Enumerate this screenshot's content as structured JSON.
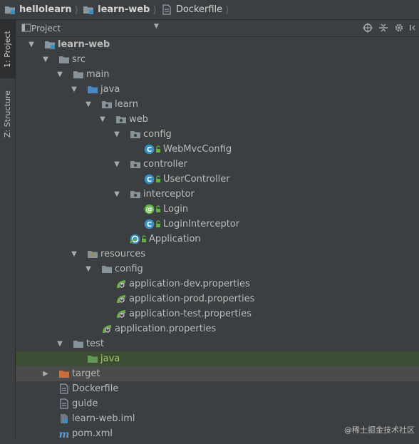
{
  "breadcrumb": [
    {
      "label": "hellolearn",
      "icon": "module-folder-icon",
      "bold": true
    },
    {
      "label": "learn-web",
      "icon": "module-folder-icon",
      "bold": true
    },
    {
      "label": "Dockerfile",
      "icon": "file-icon",
      "bold": false
    }
  ],
  "sidebar_tabs": [
    {
      "label": "1: Project",
      "active": true
    },
    {
      "label": "Z: Structure",
      "active": false
    }
  ],
  "project_header": {
    "label": "Project",
    "view_icon": "project-view-icon",
    "dropdown_icon": "caret-down-icon"
  },
  "header_tools": [
    "crosshair-icon",
    "collapse-all-icon",
    "gear-icon",
    "hide-icon"
  ],
  "tree": [
    {
      "depth": 0,
      "arrow": "down",
      "icon": "module-folder",
      "label": "learn-web",
      "bold": true
    },
    {
      "depth": 1,
      "arrow": "down",
      "icon": "folder",
      "label": "src"
    },
    {
      "depth": 2,
      "arrow": "down",
      "icon": "folder",
      "label": "main"
    },
    {
      "depth": 3,
      "arrow": "down",
      "icon": "source-folder",
      "label": "java"
    },
    {
      "depth": 4,
      "arrow": "down",
      "icon": "package",
      "label": "learn"
    },
    {
      "depth": 5,
      "arrow": "down",
      "icon": "package",
      "label": "web"
    },
    {
      "depth": 6,
      "arrow": "down",
      "icon": "package",
      "label": "config"
    },
    {
      "depth": 7,
      "arrow": "none",
      "icon": "class",
      "label": "WebMvcConfig"
    },
    {
      "depth": 6,
      "arrow": "down",
      "icon": "package",
      "label": "controller"
    },
    {
      "depth": 7,
      "arrow": "none",
      "icon": "class",
      "label": "UserController"
    },
    {
      "depth": 6,
      "arrow": "down",
      "icon": "package",
      "label": "interceptor"
    },
    {
      "depth": 7,
      "arrow": "none",
      "icon": "annotation",
      "label": "Login"
    },
    {
      "depth": 7,
      "arrow": "none",
      "icon": "class",
      "label": "LoginInterceptor"
    },
    {
      "depth": 6,
      "arrow": "none",
      "icon": "spring-boot",
      "label": "Application"
    },
    {
      "depth": 3,
      "arrow": "down",
      "icon": "resources-folder",
      "label": "resources"
    },
    {
      "depth": 4,
      "arrow": "down",
      "icon": "folder",
      "label": "config"
    },
    {
      "depth": 5,
      "arrow": "none",
      "icon": "properties",
      "label": "application-dev.properties"
    },
    {
      "depth": 5,
      "arrow": "none",
      "icon": "properties",
      "label": "application-prod.properties"
    },
    {
      "depth": 5,
      "arrow": "none",
      "icon": "properties",
      "label": "application-test.properties"
    },
    {
      "depth": 4,
      "arrow": "none",
      "icon": "properties",
      "label": "application.properties"
    },
    {
      "depth": 2,
      "arrow": "down",
      "icon": "folder",
      "label": "test"
    },
    {
      "depth": 3,
      "arrow": "none",
      "icon": "test-folder",
      "label": "java",
      "highlight": true
    },
    {
      "depth": 1,
      "arrow": "right",
      "icon": "excluded-folder",
      "label": "target",
      "selected": true
    },
    {
      "depth": 1,
      "arrow": "none",
      "icon": "file",
      "label": "Dockerfile"
    },
    {
      "depth": 1,
      "arrow": "none",
      "icon": "file",
      "label": "guide"
    },
    {
      "depth": 1,
      "arrow": "none",
      "icon": "iml-file",
      "label": "learn-web.iml"
    },
    {
      "depth": 1,
      "arrow": "none",
      "icon": "maven-file",
      "label": "pom.xml"
    }
  ],
  "watermark": "@稀土掘金技术社区",
  "colors": {
    "folder": "#87939a",
    "source": "#4a88c7",
    "resources": "#a08c54",
    "test": "#629755",
    "excluded": "#c8703a",
    "class": "#3592c4",
    "annotation": "#62b543",
    "spring": "#6db33f"
  }
}
